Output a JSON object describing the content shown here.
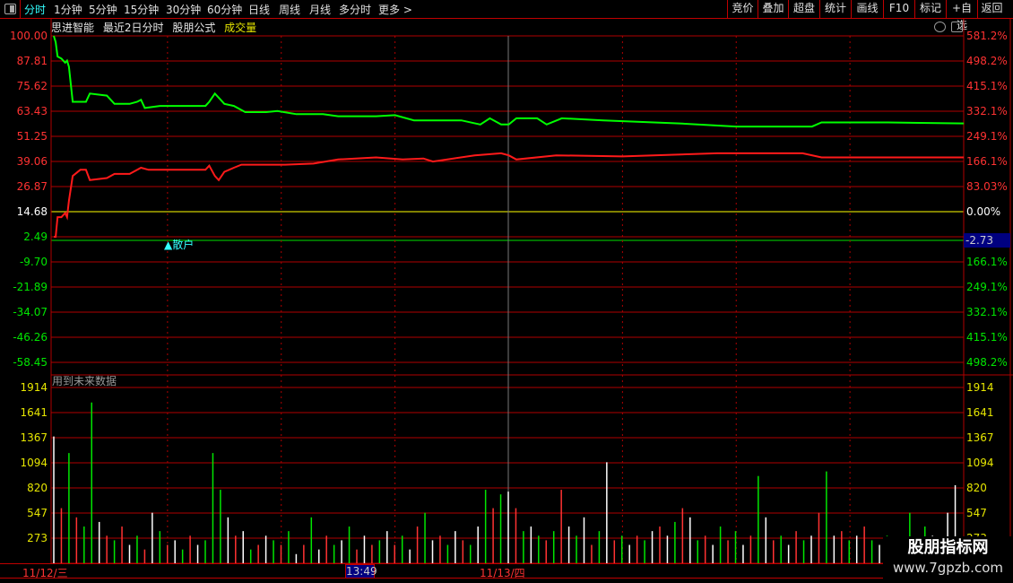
{
  "topbar": {
    "tabs": [
      {
        "label": "分时",
        "active": true
      },
      {
        "label": "1分钟"
      },
      {
        "label": "5分钟"
      },
      {
        "label": "15分钟"
      },
      {
        "label": "30分钟"
      },
      {
        "label": "60分钟"
      },
      {
        "label": "日线"
      },
      {
        "label": "周线"
      },
      {
        "label": "月线"
      },
      {
        "label": "多分时"
      },
      {
        "label": "更多 >"
      }
    ],
    "buttons": [
      "竞价",
      "叠加",
      "超盘",
      "统计",
      "画线",
      "F10",
      "标记",
      "+自选",
      "返回"
    ]
  },
  "title": {
    "name": "思进智能",
    "mode": "最近2日分时",
    "formula": "股朋公式",
    "indicator": "成交量"
  },
  "price_axis": {
    "left": [
      "100.00",
      "87.81",
      "75.62",
      "63.43",
      "51.25",
      "39.06",
      "26.87",
      "14.68",
      "2.49",
      "-9.70",
      "-21.89",
      "-34.07",
      "-46.26",
      "-58.45"
    ],
    "right": [
      "581.2%",
      "498.2%",
      "415.1%",
      "332.1%",
      "249.1%",
      "166.1%",
      "83.03%",
      "0.00%",
      "",
      "166.1%",
      "249.1%",
      "332.1%",
      "415.1%",
      "498.2%"
    ],
    "current": "-2.73"
  },
  "volume_axis": [
    "1914",
    "1641",
    "1367",
    "1094",
    "820",
    "547",
    "273"
  ],
  "future_data_label": "用到未来数据",
  "marker_label": "▲散户",
  "dates": {
    "day1": "11/12/三",
    "day2": "11/13/四",
    "cursor_time": "13:49"
  },
  "watermark": {
    "line1": "股朋指标网",
    "line2": "www.7gpzb.com"
  },
  "colors": {
    "grid": "#b00000",
    "green": "#00ff00",
    "red": "#ff1a1a",
    "yellow": "#ffff00",
    "white": "#ffffff"
  },
  "chart_data": {
    "type": "line",
    "x_range": [
      0,
      480
    ],
    "y_range": [
      -58.45,
      100
    ],
    "series": [
      {
        "name": "green-line",
        "color": "#00ff00",
        "points": [
          [
            0,
            100
          ],
          [
            1,
            97
          ],
          [
            2,
            90
          ],
          [
            4,
            89
          ],
          [
            6,
            87
          ],
          [
            7,
            88
          ],
          [
            8,
            85
          ],
          [
            10,
            68
          ],
          [
            14,
            68
          ],
          [
            17,
            68
          ],
          [
            19,
            72
          ],
          [
            28,
            71
          ],
          [
            32,
            67
          ],
          [
            40,
            67
          ],
          [
            44,
            68
          ],
          [
            46,
            69
          ],
          [
            48,
            65
          ],
          [
            56,
            66
          ],
          [
            80,
            66
          ],
          [
            82,
            68
          ],
          [
            85,
            72
          ],
          [
            87,
            70
          ],
          [
            90,
            67
          ],
          [
            95,
            66
          ],
          [
            101,
            63
          ],
          [
            112,
            63
          ],
          [
            118,
            63.5
          ],
          [
            128,
            62
          ],
          [
            142,
            62
          ],
          [
            150,
            61
          ],
          [
            170,
            61
          ],
          [
            180,
            61.5
          ],
          [
            190,
            59
          ],
          [
            215,
            59
          ],
          [
            225,
            57
          ],
          [
            230,
            60
          ],
          [
            236,
            57
          ],
          [
            240,
            57
          ],
          [
            244,
            60
          ],
          [
            255,
            60
          ],
          [
            260,
            57
          ],
          [
            268,
            60
          ],
          [
            290,
            59
          ],
          [
            330,
            57.5
          ],
          [
            360,
            56
          ],
          [
            400,
            56
          ],
          [
            405,
            58
          ],
          [
            440,
            58
          ],
          [
            480,
            57.5
          ]
        ]
      },
      {
        "name": "red-line",
        "color": "#ff1a1a",
        "points": [
          [
            0,
            2.49
          ],
          [
            1,
            2.49
          ],
          [
            2,
            12
          ],
          [
            4,
            12
          ],
          [
            6,
            14
          ],
          [
            7,
            12
          ],
          [
            8,
            20
          ],
          [
            10,
            32
          ],
          [
            14,
            35
          ],
          [
            17,
            35
          ],
          [
            19,
            30
          ],
          [
            28,
            31
          ],
          [
            32,
            33
          ],
          [
            40,
            33
          ],
          [
            46,
            36
          ],
          [
            50,
            35
          ],
          [
            80,
            35
          ],
          [
            82,
            37
          ],
          [
            85,
            32
          ],
          [
            87,
            30
          ],
          [
            90,
            34
          ],
          [
            95,
            36
          ],
          [
            99,
            37.5
          ],
          [
            122,
            37.5
          ],
          [
            137,
            38
          ],
          [
            150,
            40
          ],
          [
            170,
            41
          ],
          [
            184,
            40
          ],
          [
            195,
            40.5
          ],
          [
            200,
            39
          ],
          [
            222,
            42
          ],
          [
            236,
            43
          ],
          [
            240,
            42
          ],
          [
            244,
            40
          ],
          [
            265,
            42
          ],
          [
            300,
            41.5
          ],
          [
            350,
            43
          ],
          [
            395,
            43
          ],
          [
            405,
            41
          ],
          [
            440,
            41
          ],
          [
            480,
            41
          ]
        ]
      }
    ],
    "volume": {
      "y_range": [
        0,
        1914
      ],
      "values": [
        1380,
        600,
        1200,
        500,
        400,
        1750,
        450,
        300,
        250,
        400,
        200,
        300,
        150,
        550,
        350,
        200,
        250,
        150,
        300,
        200,
        250,
        1200,
        800,
        500,
        300,
        350,
        150,
        200,
        300,
        250,
        200,
        350,
        100,
        200,
        500,
        150,
        300,
        200,
        250,
        400,
        150,
        300,
        200,
        250,
        350,
        200,
        300,
        150,
        400,
        550,
        250,
        300,
        200,
        350,
        250,
        200,
        400,
        800,
        600,
        750,
        780,
        600,
        350,
        400,
        300,
        250,
        350,
        800,
        400,
        300,
        500,
        200,
        350,
        1100,
        250,
        300,
        200,
        300,
        250,
        350,
        400,
        300,
        450,
        600,
        500,
        250,
        300,
        200,
        400,
        250,
        350,
        200,
        300,
        950,
        500,
        250,
        300,
        200,
        350,
        250,
        300,
        550,
        1000,
        300,
        350,
        250,
        300,
        400,
        250,
        200,
        300,
        250,
        200,
        550,
        200,
        400,
        300,
        250,
        550,
        850
      ],
      "colors": "wrgrggwrgrwgrwgrwgrwgggwrwgrwgrgwrgwrgwgrwrgwrgwrgwrgwrgwgrgwrgwgrgrwgwrgwrgwrgwrwgrwgrwgrgwrgwrgwrgwrgwrgwrgwgrwgrgw"
    }
  }
}
